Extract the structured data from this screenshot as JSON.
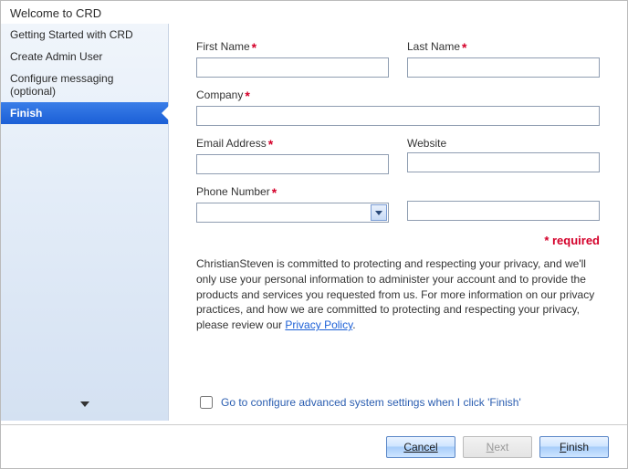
{
  "header": {
    "title": "Welcome to CRD"
  },
  "sidebar": {
    "items": [
      {
        "label": "Getting Started with CRD"
      },
      {
        "label": "Create Admin User"
      },
      {
        "label": "Configure messaging (optional)"
      },
      {
        "label": "Finish"
      }
    ]
  },
  "form": {
    "first_name": {
      "label": "First Name",
      "value": ""
    },
    "last_name": {
      "label": "Last Name",
      "value": ""
    },
    "company": {
      "label": "Company",
      "value": ""
    },
    "email": {
      "label": "Email Address",
      "value": ""
    },
    "website": {
      "label": "Website",
      "value": ""
    },
    "phone": {
      "label": "Phone Number",
      "prefix": "",
      "number": ""
    },
    "required_note": "* required",
    "privacy_text": "ChristianSteven is committed to protecting and respecting your privacy, and we'll only use your personal information to administer your account and to provide the products and services you requested from us. For more information on our privacy practices, and how we are committed to protecting and respecting your privacy, please review our ",
    "privacy_link": "Privacy Policy",
    "privacy_period": ".",
    "advanced_label": "Go to configure advanced system settings when I click 'Finish'"
  },
  "footer": {
    "cancel": "Cancel",
    "next": "Next",
    "finish": "Finish"
  }
}
